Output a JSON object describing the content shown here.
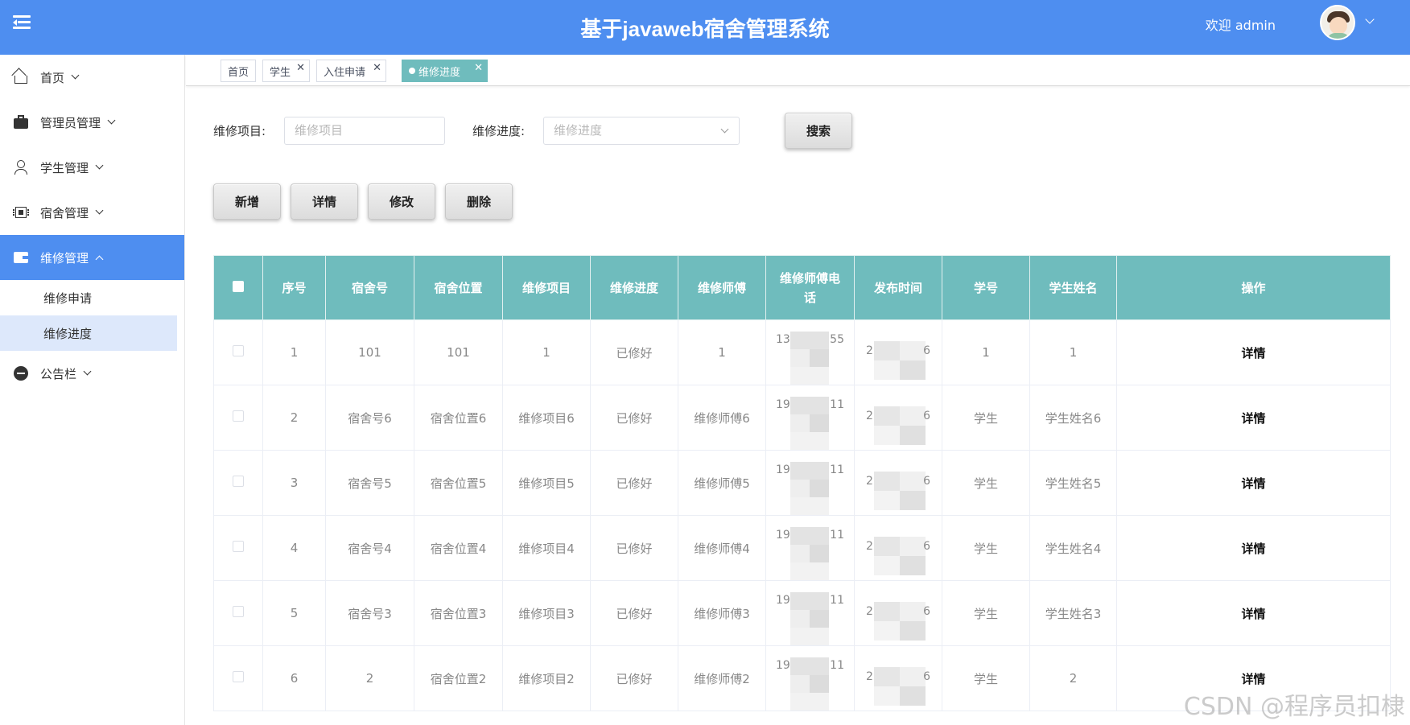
{
  "header": {
    "title": "基于javaweb宿舍管理系统",
    "welcome": "欢迎 admin"
  },
  "sidebar": {
    "items": [
      {
        "label": "首页",
        "icon": "home-icon"
      },
      {
        "label": "管理员管理",
        "icon": "briefcase-icon"
      },
      {
        "label": "学生管理",
        "icon": "user-icon"
      },
      {
        "label": "宿舍管理",
        "icon": "chip-icon"
      },
      {
        "label": "维修管理",
        "icon": "wallet-icon",
        "active": true
      },
      {
        "label": "公告栏",
        "icon": "chat-bubble-icon"
      }
    ],
    "sub_items": [
      {
        "label": "维修申请"
      },
      {
        "label": "维修进度",
        "active": true
      }
    ]
  },
  "tabs": [
    {
      "label": "首页"
    },
    {
      "label": "学生"
    },
    {
      "label": "入住申请"
    },
    {
      "label": "维修进度",
      "active": true
    }
  ],
  "search": {
    "item_label": "维修项目:",
    "item_placeholder": "维修项目",
    "progress_label": "维修进度:",
    "progress_placeholder": "维修进度",
    "search_button": "搜索"
  },
  "actions": {
    "add": "新增",
    "detail": "详情",
    "edit": "修改",
    "delete": "删除"
  },
  "table": {
    "columns": [
      "序号",
      "宿舍号",
      "宿舍位置",
      "维修项目",
      "维修进度",
      "维修师傅",
      "维修师傅电话",
      "发布时间",
      "学号",
      "学生姓名",
      "操作"
    ],
    "rows": [
      {
        "no": "1",
        "dorm": "101",
        "location": "101",
        "item": "1",
        "progress": "已修好",
        "worker": "1",
        "phone_a": "13",
        "phone_b": "55",
        "time_a": "2",
        "time_b": "6",
        "student_no": "1",
        "student_name": "1",
        "op": "详情"
      },
      {
        "no": "2",
        "dorm": "宿舍号6",
        "location": "宿舍位置6",
        "item": "维修项目6",
        "progress": "已修好",
        "worker": "维修师傅6",
        "phone_a": "19",
        "phone_b": "11",
        "time_a": "2",
        "time_b": "6",
        "student_no": "学生",
        "student_name": "学生姓名6",
        "op": "详情"
      },
      {
        "no": "3",
        "dorm": "宿舍号5",
        "location": "宿舍位置5",
        "item": "维修项目5",
        "progress": "已修好",
        "worker": "维修师傅5",
        "phone_a": "19",
        "phone_b": "11",
        "time_a": "2",
        "time_b": "6",
        "student_no": "学生",
        "student_name": "学生姓名5",
        "op": "详情"
      },
      {
        "no": "4",
        "dorm": "宿舍号4",
        "location": "宿舍位置4",
        "item": "维修项目4",
        "progress": "已修好",
        "worker": "维修师傅4",
        "phone_a": "19",
        "phone_b": "11",
        "time_a": "2",
        "time_b": "6",
        "student_no": "学生",
        "student_name": "学生姓名4",
        "op": "详情"
      },
      {
        "no": "5",
        "dorm": "宿舍号3",
        "location": "宿舍位置3",
        "item": "维修项目3",
        "progress": "已修好",
        "worker": "维修师傅3",
        "phone_a": "19",
        "phone_b": "11",
        "time_a": "2",
        "time_b": "6",
        "student_no": "学生",
        "student_name": "学生姓名3",
        "op": "详情"
      },
      {
        "no": "6",
        "dorm": "2",
        "location": "宿舍位置2",
        "item": "维修项目2",
        "progress": "已修好",
        "worker": "维修师傅2",
        "phone_a": "19",
        "phone_b": "11",
        "time_a": "2",
        "time_b": "6",
        "student_no": "学生",
        "student_name": "2",
        "op": "详情"
      }
    ]
  },
  "watermark": "CSDN @程序员扣棣",
  "colors": {
    "header_bg": "#4e8ef0",
    "table_header_bg": "#6fbcbd",
    "active_tab_bg": "#6fbcbd",
    "active_sub_bg": "#dde8fb"
  }
}
